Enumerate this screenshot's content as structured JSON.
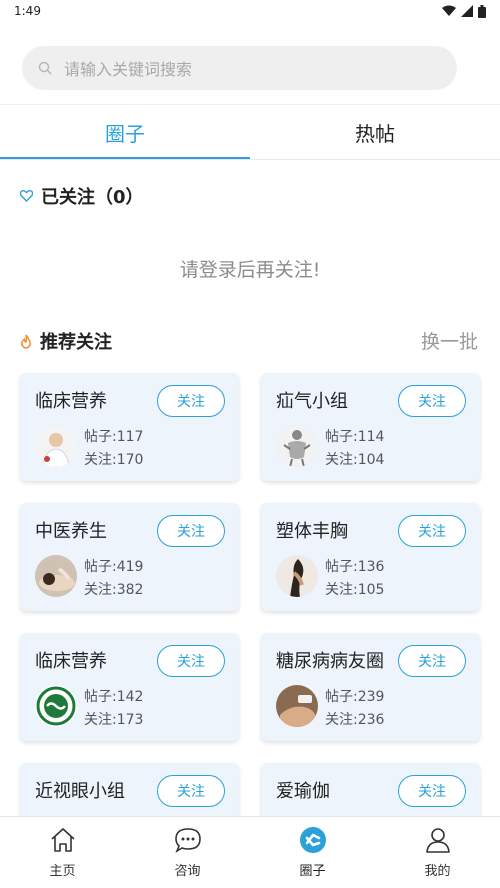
{
  "status": {
    "time": "1:49"
  },
  "search": {
    "placeholder": "请输入关键词搜索"
  },
  "tabs": [
    {
      "label": "圈子"
    },
    {
      "label": "热帖"
    }
  ],
  "followed": {
    "title": "已关注（0）",
    "empty_text": "请登录后再关注!"
  },
  "recommend": {
    "title": "推荐关注",
    "refresh_label": "换一批"
  },
  "groups": [
    {
      "name": "临床营养",
      "follow_label": "关注",
      "posts": "帖子:117",
      "followers": "关注:170",
      "avatar": "doctor-avatar"
    },
    {
      "name": "疝气小组",
      "follow_label": "关注",
      "posts": "帖子:114",
      "followers": "关注:104",
      "avatar": "anatomy-avatar"
    },
    {
      "name": "中医养生",
      "follow_label": "关注",
      "posts": "帖子:419",
      "followers": "关注:382",
      "avatar": "massage-avatar"
    },
    {
      "name": "塑体丰胸",
      "follow_label": "关注",
      "posts": "帖子:136",
      "followers": "关注:105",
      "avatar": "body-avatar"
    },
    {
      "name": "临床营养",
      "follow_label": "关注",
      "posts": "帖子:142",
      "followers": "关注:173",
      "avatar": "logo-avatar"
    },
    {
      "name": "糖尿病病友圈",
      "follow_label": "关注",
      "posts": "帖子:239",
      "followers": "关注:236",
      "avatar": "hand-avatar"
    },
    {
      "name": "近视眼小组",
      "follow_label": "关注"
    },
    {
      "name": "爱瑜伽",
      "follow_label": "关注"
    }
  ],
  "nav": [
    {
      "label": "主页",
      "icon": "home-icon"
    },
    {
      "label": "咨询",
      "icon": "chat-icon"
    },
    {
      "label": "圈子",
      "icon": "circle-icon"
    },
    {
      "label": "我的",
      "icon": "user-icon"
    }
  ],
  "colors": {
    "accent": "#2aa1d8",
    "card_bg": "#eef4fb",
    "flame": "#f08a24"
  }
}
